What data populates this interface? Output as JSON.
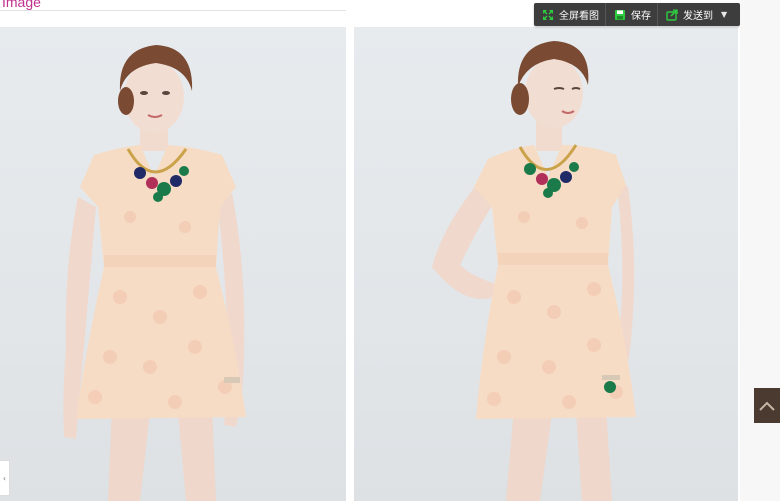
{
  "section": {
    "title": "Image"
  },
  "toolbar": {
    "fullscreen_label": "全屏看图",
    "save_label": "保存",
    "send_label": "发送到"
  },
  "icons": {
    "fullscreen": "expand-icon",
    "save": "floppy-disk-icon",
    "send": "send-to-icon",
    "dropdown": "caret-down-icon",
    "back_to_top": "chevron-up-icon"
  },
  "colors": {
    "title_accent": "#c0308e",
    "toolbar_bg": "#3d3d3d",
    "toolbar_icon_green": "#2ecc40",
    "back_top_bg": "#4a3a2f"
  },
  "photos": [
    {
      "subject": "model-front-view"
    },
    {
      "subject": "model-side-pose"
    }
  ]
}
